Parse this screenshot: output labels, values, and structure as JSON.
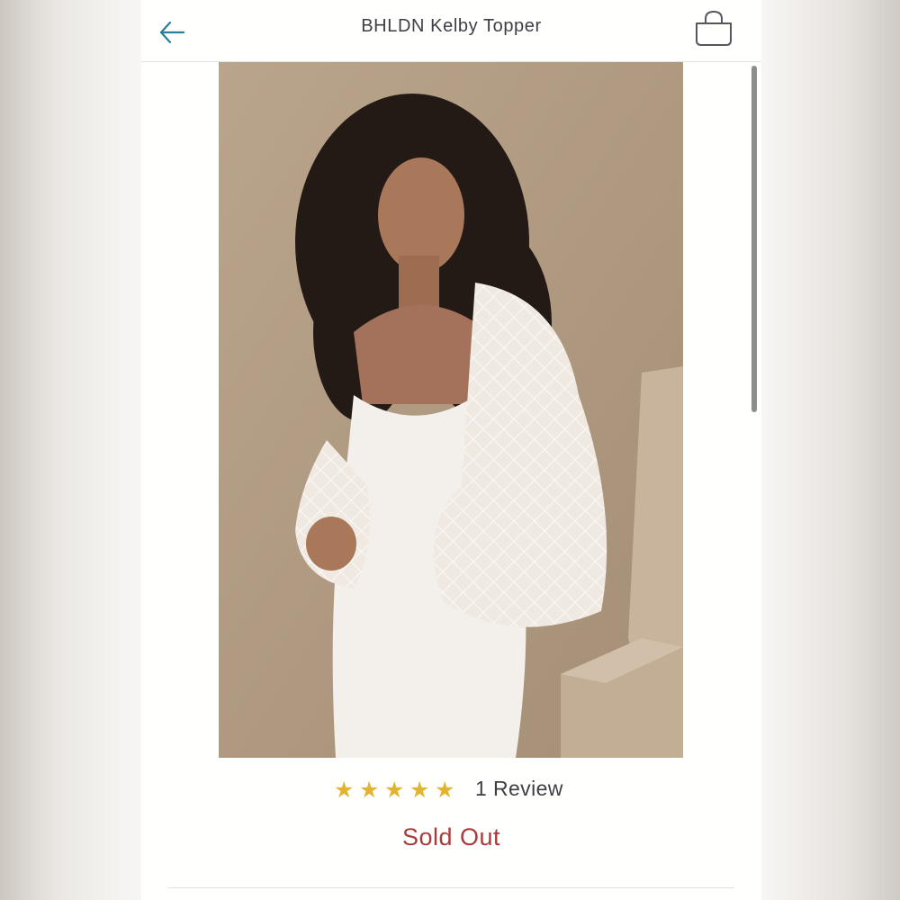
{
  "header": {
    "title": "BHLDN Kelby Topper",
    "back_icon": "arrow-left-icon",
    "bag_icon": "shopping-bag-icon"
  },
  "product": {
    "rating_stars": 5,
    "rating_max": 5,
    "review_label": "1 Review",
    "status": "Sold Out"
  },
  "colors": {
    "accent": "#2c7d9a",
    "star": "#e1b531",
    "sold_out": "#a93b3b",
    "text": "#3d3f45"
  }
}
